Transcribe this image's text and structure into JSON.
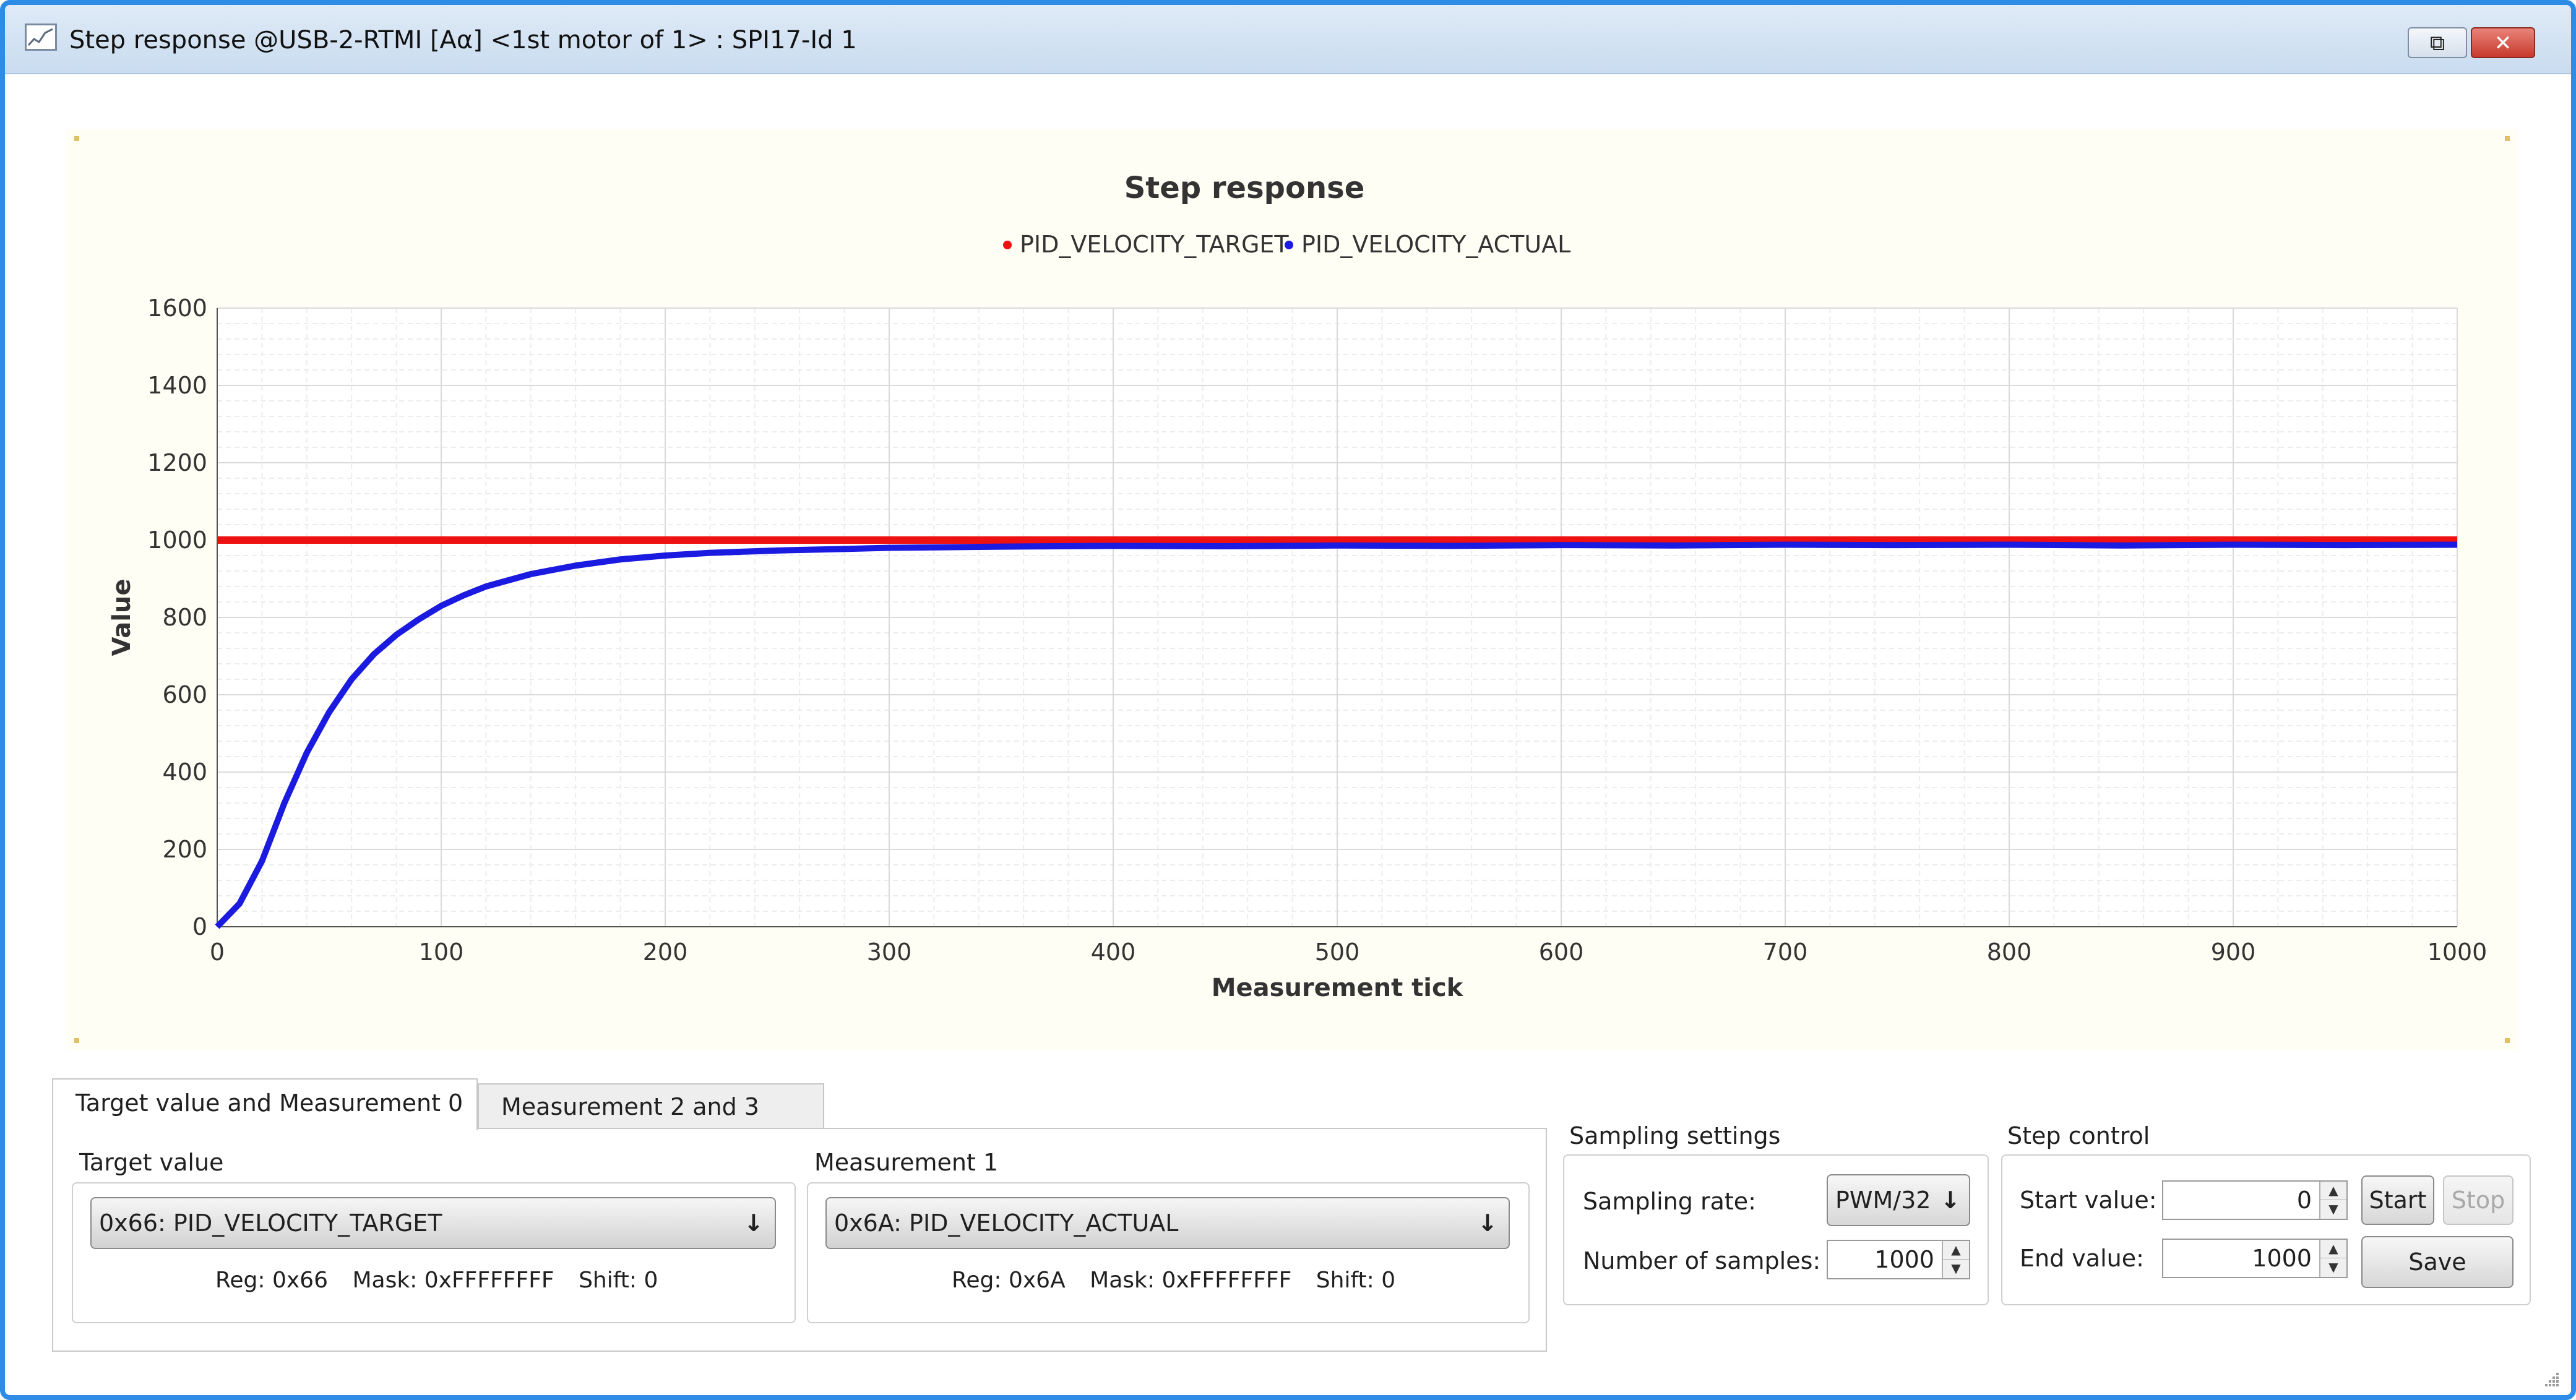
{
  "window": {
    "title": "Step response @USB-2-RTMI [Aα] <1st motor of 1> : SPI17-Id 1",
    "restore_glyph": "⧉",
    "close_glyph": "✕",
    "accent": "#2d8ce6"
  },
  "chart_data": {
    "type": "line",
    "title": "Step response",
    "xlabel": "Measurement tick",
    "ylabel": "Value",
    "xlim": [
      0,
      1000
    ],
    "ylim": [
      0,
      1600
    ],
    "x_ticks": [
      0,
      100,
      200,
      300,
      400,
      500,
      600,
      700,
      800,
      900,
      1000
    ],
    "y_ticks": [
      0,
      200,
      400,
      600,
      800,
      1000,
      1200,
      1400,
      1600
    ],
    "grid": true,
    "legend_position": "top-center",
    "series": [
      {
        "name": "PID_VELOCITY_TARGET",
        "color": "#ee1111",
        "x": [
          0,
          100,
          200,
          300,
          400,
          500,
          600,
          700,
          800,
          900,
          1000
        ],
        "y": [
          1000,
          1000,
          1000,
          1000,
          1000,
          1000,
          1000,
          1000,
          1000,
          1000,
          1000
        ]
      },
      {
        "name": "PID_VELOCITY_ACTUAL",
        "color": "#1a1ae0",
        "x": [
          0,
          10,
          20,
          30,
          40,
          50,
          60,
          70,
          80,
          90,
          100,
          110,
          120,
          140,
          160,
          180,
          200,
          220,
          250,
          280,
          300,
          350,
          400,
          450,
          500,
          550,
          600,
          650,
          700,
          750,
          800,
          850,
          900,
          950,
          1000
        ],
        "y": [
          0,
          60,
          170,
          320,
          450,
          555,
          640,
          705,
          755,
          795,
          830,
          857,
          880,
          912,
          934,
          950,
          960,
          967,
          973,
          977,
          980,
          983,
          985,
          984,
          986,
          985,
          987,
          986,
          988,
          987,
          988,
          986,
          988,
          987,
          988
        ]
      }
    ]
  },
  "tabs": [
    {
      "label": "Target value and Measurement 0",
      "active": true
    },
    {
      "label": "Measurement 2 and 3",
      "active": false
    }
  ],
  "target_group": {
    "label": "Target value",
    "combo_value": "0x66: PID_VELOCITY_TARGET",
    "reg": "Reg: 0x66",
    "mask": "Mask: 0xFFFFFFFF",
    "shift": "Shift: 0"
  },
  "measurement_group": {
    "label": "Measurement 1",
    "combo_value": "0x6A: PID_VELOCITY_ACTUAL",
    "reg": "Reg: 0x6A",
    "mask": "Mask: 0xFFFFFFFF",
    "shift": "Shift: 0"
  },
  "combo_arrow": "↓",
  "sampling": {
    "title": "Sampling settings",
    "rate_label": "Sampling rate:",
    "rate_value": "PWM/32",
    "samples_label": "Number of samples:",
    "samples_value": "1000"
  },
  "step_control": {
    "title": "Step control",
    "start_label": "Start value:",
    "start_value": "0",
    "end_label": "End value:",
    "end_value": "1000",
    "start_button": "Start",
    "stop_button": "Stop",
    "save_button": "Save"
  },
  "spin_up": "▲",
  "spin_down": "▼"
}
